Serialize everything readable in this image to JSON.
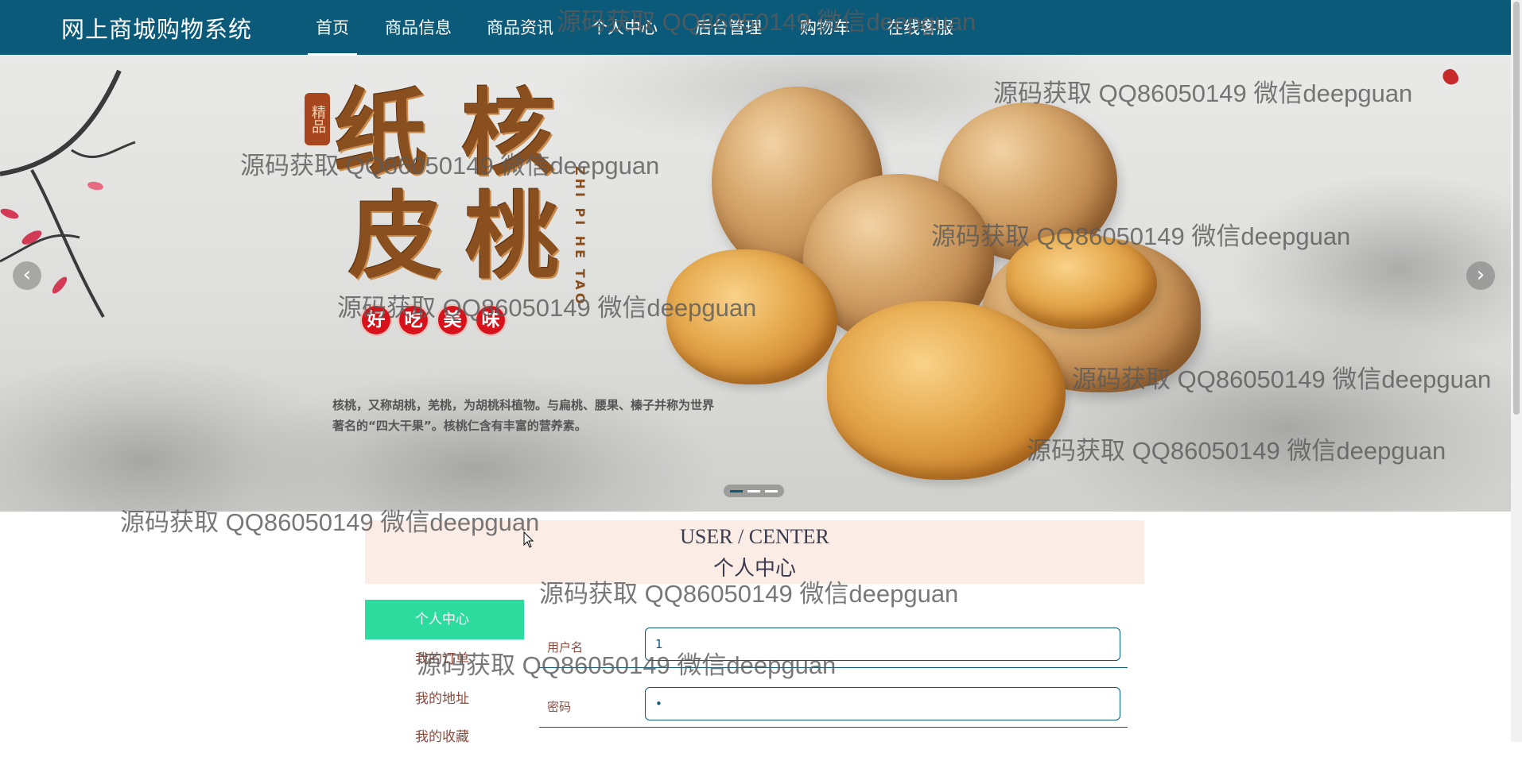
{
  "site": {
    "title": "网上商城购物系统"
  },
  "nav": {
    "items": [
      {
        "label": "首页",
        "active": true
      },
      {
        "label": "商品信息"
      },
      {
        "label": "商品资讯"
      },
      {
        "label": "个人中心"
      },
      {
        "label": "后台管理"
      },
      {
        "label": "购物车"
      },
      {
        "label": "在线客服"
      }
    ]
  },
  "banner": {
    "seal_text": "精品",
    "title_chars": [
      "纸",
      "核",
      "皮",
      "桃"
    ],
    "pinyin": "ZHI PI HE TAO",
    "tags": [
      "好",
      "吃",
      "美",
      "味"
    ],
    "description": "核桃，又称胡桃，羌桃，为胡桃科植物。与扁桃、腰果、榛子并称为世界著名的“四大干果”。核桃仁含有丰富的营养素。",
    "prev_arrow": "‹",
    "next_arrow": "›"
  },
  "user_center": {
    "title_en": "USER / CENTER",
    "title_cn": "个人中心",
    "sidebar": [
      {
        "label": "个人中心",
        "active": true
      },
      {
        "label": "我的订单"
      },
      {
        "label": "我的地址"
      },
      {
        "label": "我的收藏"
      }
    ],
    "form": {
      "username_label": "用户名",
      "username_value": "1",
      "password_label": "密码",
      "password_value": "•"
    }
  },
  "watermark_text": "源码获取 QQ86050149 微信deepguan",
  "colors": {
    "nav_bg": "#0b5a7a",
    "active_side": "#2ddb9f",
    "header_bg": "#fbede6"
  }
}
